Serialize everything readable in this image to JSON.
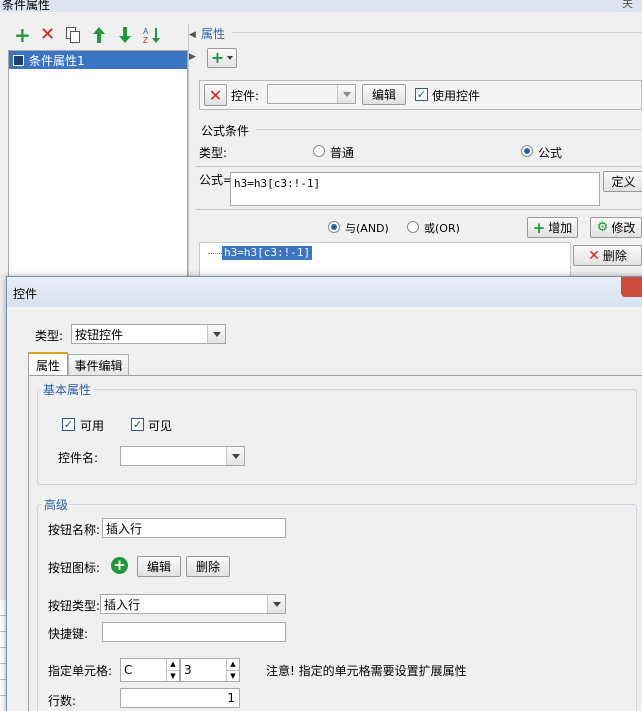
{
  "window": {
    "title": "条件属性",
    "corner_label": "关"
  },
  "toolbar": {
    "icons": [
      "add-icon",
      "delete-icon",
      "copy-icon",
      "move-up-icon",
      "move-down-icon",
      "sort-icon"
    ]
  },
  "tree": {
    "items": [
      "条件属性1"
    ]
  },
  "right_panel": {
    "property_legend": "属性",
    "control_label": "控件:",
    "edit_button": "编辑",
    "use_control_label": "使用控件",
    "formula_condition_legend": "公式条件",
    "type_label": "类型:",
    "radio_normal": "普通",
    "radio_formula": "公式",
    "formula_label": "公式=",
    "formula_value": "h3=h3[c3:!-1]",
    "define_button": "定义",
    "and_label": "与(AND)",
    "or_label": "或(OR)",
    "add_button": "增加",
    "modify_button": "修改",
    "delete_button": "删除",
    "list_item": "h3=h3[c3:!-1]"
  },
  "dialog": {
    "title": "控件",
    "type_label": "类型:",
    "type_value": "按钮控件",
    "tabs": [
      "属性",
      "事件编辑"
    ],
    "basic_legend": "基本属性",
    "enabled_label": "可用",
    "visible_label": "可见",
    "name_label": "控件名:",
    "name_value": "",
    "advanced_legend": "高级",
    "button_name_label": "按钮名称:",
    "button_name_value": "插入行",
    "button_icon_label": "按钮图标:",
    "icon_edit_button": "编辑",
    "icon_delete_button": "删除",
    "button_type_label": "按钮类型:",
    "button_type_value": "插入行",
    "shortcut_label": "快捷键:",
    "shortcut_value": "",
    "cell_label": "指定单元格:",
    "cell_col": "C",
    "cell_row": "3",
    "cell_note": "注意! 指定的单元格需要设置扩展属性",
    "rows_label": "行数:",
    "rows_value": "1"
  },
  "colors": {
    "accent": "#2b5fa8",
    "selection": "#3a75c4",
    "green": "#1e9a3a",
    "red": "#d62020"
  }
}
